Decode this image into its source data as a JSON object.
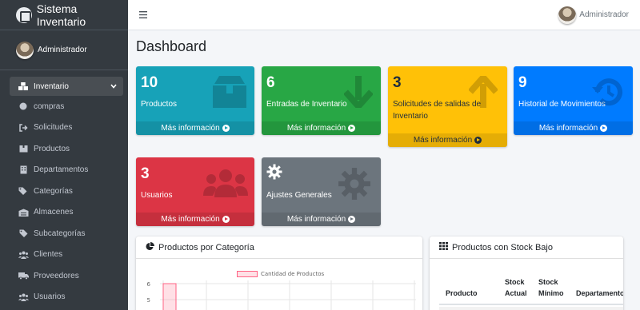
{
  "brand": {
    "title": "Sistema Inventario"
  },
  "user": {
    "name": "Administrador"
  },
  "sidebar": {
    "items": [
      {
        "label": "Inventario",
        "icon": "boxes-icon",
        "active": true
      },
      {
        "label": "compras",
        "icon": "circle-icon"
      },
      {
        "label": "Solicitudes",
        "icon": "sign-out-icon"
      },
      {
        "label": "Productos",
        "icon": "box-icon"
      },
      {
        "label": "Departamentos",
        "icon": "building-icon"
      },
      {
        "label": "Categorías",
        "icon": "tags-icon"
      },
      {
        "label": "Almacenes",
        "icon": "warehouse-icon"
      },
      {
        "label": "Subcategorías",
        "icon": "tag-icon"
      },
      {
        "label": "Clientes",
        "icon": "users-icon"
      },
      {
        "label": "Proveedores",
        "icon": "truck-icon"
      },
      {
        "label": "Usuarios",
        "icon": "users-icon"
      }
    ]
  },
  "topbar": {
    "user_name": "Administrador"
  },
  "page": {
    "title": "Dashboard"
  },
  "boxes": [
    {
      "value": "10",
      "label": "Productos",
      "footer": "Más información",
      "color": "#17a2b8",
      "icon": "box-icon"
    },
    {
      "value": "6",
      "label": "Entradas de Inventario",
      "footer": "Más información",
      "color": "#28a745",
      "icon": "arrow-down-icon"
    },
    {
      "value": "3",
      "label": "Solicitudes de salidas de Inventario",
      "footer": "Más información",
      "color": "#ffc107",
      "icon": "arrow-up-icon"
    },
    {
      "value": "9",
      "label": "Historial de Movimientos",
      "footer": "Más información",
      "color": "#007bff",
      "icon": "history-icon"
    },
    {
      "value": "3",
      "label": "Usuarios",
      "footer": "Más información",
      "color": "#dc3545",
      "icon": "users-icon"
    },
    {
      "value": "",
      "label": "Ajustes Generales",
      "footer": "Más información",
      "color": "#6c757d",
      "icon": "gear-icon"
    }
  ],
  "category_card": {
    "title": "Productos por Categoría",
    "legend": "Cantidad de Productos"
  },
  "chart_data": {
    "type": "bar",
    "title": "",
    "series": [
      {
        "name": "Cantidad de Productos",
        "values": [
          6
        ]
      }
    ],
    "y_ticks": [
      "6",
      "5"
    ],
    "ylim": [
      0,
      6
    ],
    "grid": true,
    "legend_position": "top",
    "colors": {
      "fill": "rgba(255,99,132,0.2)",
      "stroke": "#ff6384"
    }
  },
  "stock_card": {
    "title": "Productos con Stock Bajo",
    "columns": [
      "Producto",
      "Stock Actual",
      "Stock Mínimo",
      "Departamento"
    ]
  }
}
